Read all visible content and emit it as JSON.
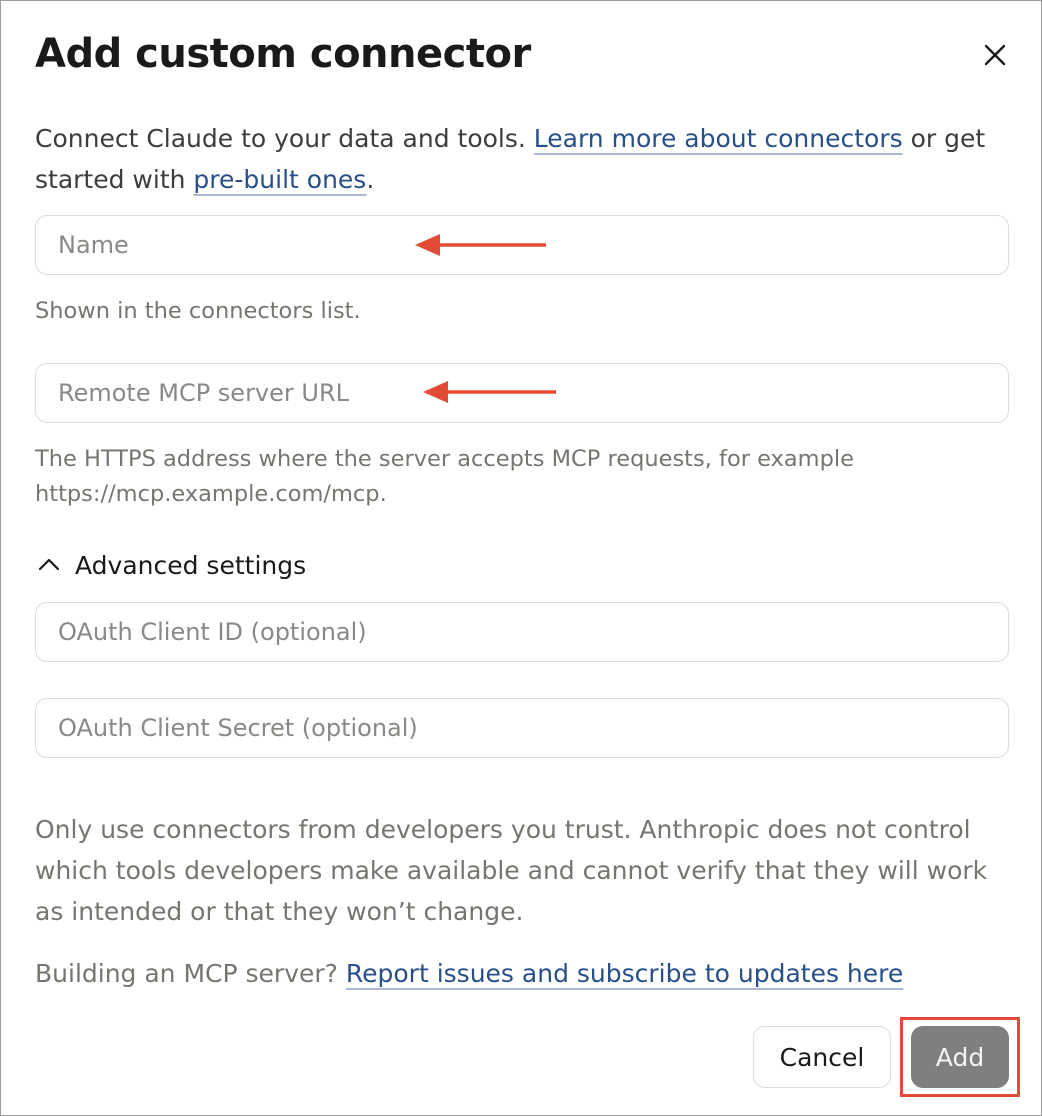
{
  "dialog": {
    "title": "Add custom connector",
    "close_label": "×"
  },
  "intro": {
    "text_before": "Connect Claude to your data and tools. ",
    "link_learn_more": "Learn more about connectors",
    "text_middle": " or get started with ",
    "link_prebuilt": "pre-built ones",
    "text_after": "."
  },
  "fields": {
    "name": {
      "placeholder": "Name",
      "value": "",
      "hint": "Shown in the connectors list."
    },
    "url": {
      "placeholder": "Remote MCP server URL",
      "value": "",
      "hint": "The HTTPS address where the server accepts MCP requests, for example https://mcp.example.com/mcp."
    },
    "client_id": {
      "placeholder": "OAuth Client ID (optional)",
      "value": ""
    },
    "client_secret": {
      "placeholder": "OAuth Client Secret (optional)",
      "value": ""
    }
  },
  "advanced": {
    "label": "Advanced settings",
    "icon": "chevron-up-icon",
    "expanded": true
  },
  "warning": {
    "text": "Only use connectors from developers you trust. Anthropic does not control which tools developers make available and cannot verify that they will work as intended or that they won’t change."
  },
  "footer_note": {
    "text": "Building an MCP server? ",
    "link": "Report issues and subscribe to updates here"
  },
  "buttons": {
    "cancel": "Cancel",
    "add": "Add"
  },
  "colors": {
    "link": "#27508a",
    "annotation_red": "#e24b35",
    "add_button_disabled": "#7f7f7d",
    "border": "#dcdcd8",
    "muted_text": "#76756f"
  }
}
